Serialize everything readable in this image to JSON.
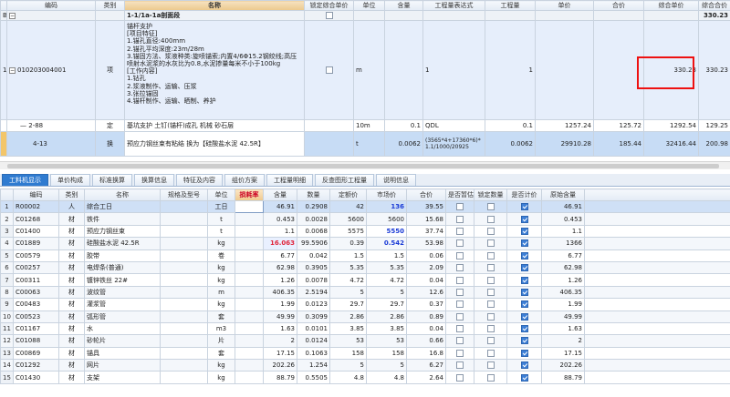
{
  "top_grid": {
    "headers": [
      "编码",
      "类别",
      "名称",
      "锁定综合单价",
      "单位",
      "含量",
      "工程量表达式",
      "工程量",
      "单价",
      "合价",
      "综合单价",
      "综合合价"
    ],
    "section_row": {
      "code": "B3",
      "name": "1-1/1a-1a剖面段",
      "total": "330.23"
    },
    "main_row": {
      "row_num": "1",
      "code": "010203004001",
      "type": "项",
      "desc_lines": [
        "锚杆支护",
        "[项目特征]",
        "1.锚孔直径:400mm",
        "2.锚孔平均深度:23m/28m",
        "3.锚固方法、浆液种类:旋喷锚索;内置4/6Φ15.2钢绞线;高压喷射水泥浆的水灰比为0.8,水泥掺量每米不小于100kg",
        "[工作内容]",
        "1.钻孔",
        "2.浆液制作、运输、压浆",
        "3.张拉锚固",
        "4.锚杆制作、运输、晒制、养护"
      ],
      "unit": "m",
      "qty_expr": "1",
      "qty": "1",
      "comp_price": "330.23",
      "comp_total": "330.23"
    },
    "sub_row": {
      "code": "2-88",
      "type": "定",
      "name": "基坑支护 土钉(锚杆)成孔 机械 砂石层",
      "unit": "10m",
      "content": "0.1",
      "qty_expr": "QDL",
      "qty": "0.1",
      "price": "1257.24",
      "total": "125.72",
      "comp_price": "1292.54",
      "comp_total": "129.25"
    },
    "sel_row": {
      "code": "4-13",
      "type": "换",
      "name": "预应力钢丝束有粘结 换为【硅酸盐水泥 42.5R】",
      "unit": "t",
      "content": "0.0062",
      "qty_expr": "(3565*4+17360*6)*1.1/1000/20925",
      "qty": "0.0062",
      "price": "29910.28",
      "total": "185.44",
      "comp_price": "32416.44",
      "comp_total": "200.98"
    }
  },
  "tabs": [
    "工料机显示",
    "单价构成",
    "标准换算",
    "换算信息",
    "特征及内容",
    "组价方案",
    "工程量明细",
    "反查图形工程量",
    "说明信息"
  ],
  "bottom_grid": {
    "headers": [
      "编码",
      "类别",
      "名称",
      "规格及型号",
      "单位",
      "损耗率",
      "含量",
      "数量",
      "定额价",
      "市场价",
      "合价",
      "是否暂估",
      "锁定数量",
      "是否计价",
      "原始含量"
    ],
    "rows": [
      {
        "n": "1",
        "code": "R00002",
        "type": "人",
        "name": "综合工日",
        "spec": "",
        "unit": "工日",
        "loss": "",
        "content": "46.91",
        "qty": "0.2908",
        "price": "42",
        "market": "136",
        "total": "39.55",
        "est": false,
        "lock": false,
        "priced": true,
        "orig": "46.91"
      },
      {
        "n": "2",
        "code": "C01268",
        "type": "材",
        "name": "铁件",
        "spec": "",
        "unit": "t",
        "loss": "",
        "content": "0.453",
        "qty": "0.0028",
        "price": "5600",
        "market": "5600",
        "total": "15.68",
        "est": false,
        "lock": false,
        "priced": true,
        "orig": "0.453"
      },
      {
        "n": "3",
        "code": "C01400",
        "type": "材",
        "name": "预应力钢丝束",
        "spec": "",
        "unit": "t",
        "loss": "",
        "content": "1.1",
        "qty": "0.0068",
        "price": "5575",
        "market": "5550",
        "total": "37.74",
        "est": false,
        "lock": false,
        "priced": true,
        "orig": "1.1"
      },
      {
        "n": "4",
        "code": "C01889",
        "type": "材",
        "name": "硅酸盐水泥 42.5R",
        "spec": "",
        "unit": "kg",
        "loss": "",
        "content": "16.063",
        "qty": "99.5906",
        "price": "0.39",
        "market": "0.542",
        "total": "53.98",
        "est": false,
        "lock": false,
        "priced": true,
        "orig": "1366"
      },
      {
        "n": "5",
        "code": "C00579",
        "type": "材",
        "name": "胶带",
        "spec": "",
        "unit": "卷",
        "loss": "",
        "content": "6.77",
        "qty": "0.042",
        "price": "1.5",
        "market": "1.5",
        "total": "0.06",
        "est": false,
        "lock": false,
        "priced": true,
        "orig": "6.77"
      },
      {
        "n": "6",
        "code": "C00257",
        "type": "材",
        "name": "电焊条(普通)",
        "spec": "",
        "unit": "kg",
        "loss": "",
        "content": "62.98",
        "qty": "0.3905",
        "price": "5.35",
        "market": "5.35",
        "total": "2.09",
        "est": false,
        "lock": false,
        "priced": true,
        "orig": "62.98"
      },
      {
        "n": "7",
        "code": "C00311",
        "type": "材",
        "name": "镀锌铁丝 22#",
        "spec": "",
        "unit": "kg",
        "loss": "",
        "content": "1.26",
        "qty": "0.0078",
        "price": "4.72",
        "market": "4.72",
        "total": "0.04",
        "est": false,
        "lock": false,
        "priced": true,
        "orig": "1.26"
      },
      {
        "n": "8",
        "code": "C00063",
        "type": "材",
        "name": "波纹管",
        "spec": "",
        "unit": "m",
        "loss": "",
        "content": "406.35",
        "qty": "2.5194",
        "price": "5",
        "market": "5",
        "total": "12.6",
        "est": false,
        "lock": false,
        "priced": true,
        "orig": "406.35"
      },
      {
        "n": "9",
        "code": "C00483",
        "type": "材",
        "name": "灌浆管",
        "spec": "",
        "unit": "kg",
        "loss": "",
        "content": "1.99",
        "qty": "0.0123",
        "price": "29.7",
        "market": "29.7",
        "total": "0.37",
        "est": false,
        "lock": false,
        "priced": true,
        "orig": "1.99"
      },
      {
        "n": "10",
        "code": "C00523",
        "type": "材",
        "name": "弧形管",
        "spec": "",
        "unit": "套",
        "loss": "",
        "content": "49.99",
        "qty": "0.3099",
        "price": "2.86",
        "market": "2.86",
        "total": "0.89",
        "est": false,
        "lock": false,
        "priced": true,
        "orig": "49.99"
      },
      {
        "n": "11",
        "code": "C01167",
        "type": "材",
        "name": "水",
        "spec": "",
        "unit": "m3",
        "loss": "",
        "content": "1.63",
        "qty": "0.0101",
        "price": "3.85",
        "market": "3.85",
        "total": "0.04",
        "est": false,
        "lock": false,
        "priced": true,
        "orig": "1.63"
      },
      {
        "n": "12",
        "code": "C01088",
        "type": "材",
        "name": "砂轮片",
        "spec": "",
        "unit": "片",
        "loss": "",
        "content": "2",
        "qty": "0.0124",
        "price": "53",
        "market": "53",
        "total": "0.66",
        "est": false,
        "lock": false,
        "priced": true,
        "orig": "2"
      },
      {
        "n": "13",
        "code": "C00869",
        "type": "材",
        "name": "锚具",
        "spec": "",
        "unit": "套",
        "loss": "",
        "content": "17.15",
        "qty": "0.1063",
        "price": "158",
        "market": "158",
        "total": "16.8",
        "est": false,
        "lock": false,
        "priced": true,
        "orig": "17.15"
      },
      {
        "n": "14",
        "code": "C01292",
        "type": "材",
        "name": "网片",
        "spec": "",
        "unit": "kg",
        "loss": "",
        "content": "202.26",
        "qty": "1.254",
        "price": "5",
        "market": "5",
        "total": "6.27",
        "est": false,
        "lock": false,
        "priced": true,
        "orig": "202.26"
      },
      {
        "n": "15",
        "code": "C01430",
        "type": "材",
        "name": "支架",
        "spec": "",
        "unit": "kg",
        "loss": "",
        "content": "88.79",
        "qty": "0.5505",
        "price": "4.8",
        "market": "4.8",
        "total": "2.64",
        "est": false,
        "lock": false,
        "priced": true,
        "orig": "88.79"
      }
    ]
  },
  "colors": {
    "tab_active": "#2f7bd0",
    "highlight_box": "#e11111",
    "market_price_changed": "#1a3bd6",
    "content_changed": "#e0243b"
  }
}
